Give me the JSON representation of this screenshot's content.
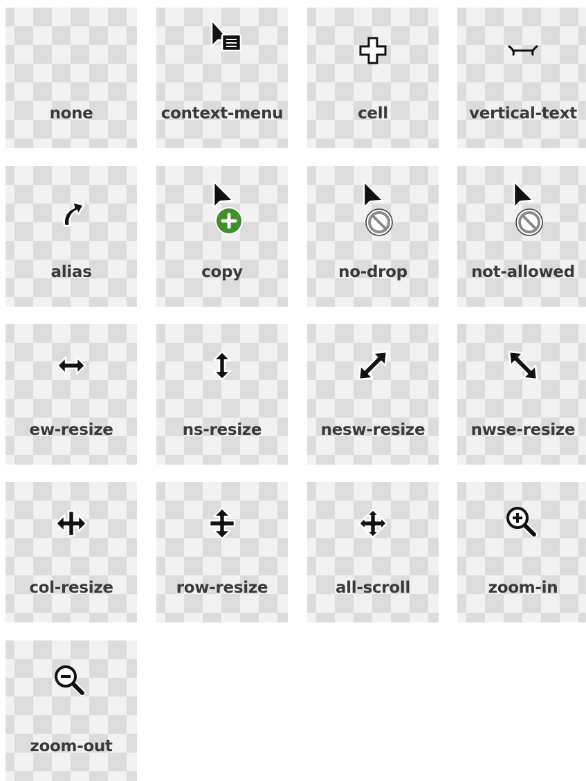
{
  "cursors": [
    {
      "label": "none",
      "icon": "none"
    },
    {
      "label": "context-menu",
      "icon": "context-menu-icon"
    },
    {
      "label": "cell",
      "icon": "cell-icon"
    },
    {
      "label": "vertical-text",
      "icon": "vertical-text-icon"
    },
    {
      "label": "alias",
      "icon": "alias-icon"
    },
    {
      "label": "copy",
      "icon": "copy-icon"
    },
    {
      "label": "no-drop",
      "icon": "no-drop-icon"
    },
    {
      "label": "not-allowed",
      "icon": "not-allowed-icon"
    },
    {
      "label": "ew-resize",
      "icon": "ew-resize-icon"
    },
    {
      "label": "ns-resize",
      "icon": "ns-resize-icon"
    },
    {
      "label": "nesw-resize",
      "icon": "nesw-resize-icon"
    },
    {
      "label": "nwse-resize",
      "icon": "nwse-resize-icon"
    },
    {
      "label": "col-resize",
      "icon": "col-resize-icon"
    },
    {
      "label": "row-resize",
      "icon": "row-resize-icon"
    },
    {
      "label": "all-scroll",
      "icon": "all-scroll-icon"
    },
    {
      "label": "zoom-in",
      "icon": "zoom-in-icon"
    },
    {
      "label": "zoom-out",
      "icon": "zoom-out-icon"
    }
  ],
  "colors": {
    "tile_light": "#f1f1f2",
    "tile_dark": "#dcdcdd",
    "label_text": "#3a3a3a",
    "copy_badge_green": "#3f8f2a"
  }
}
